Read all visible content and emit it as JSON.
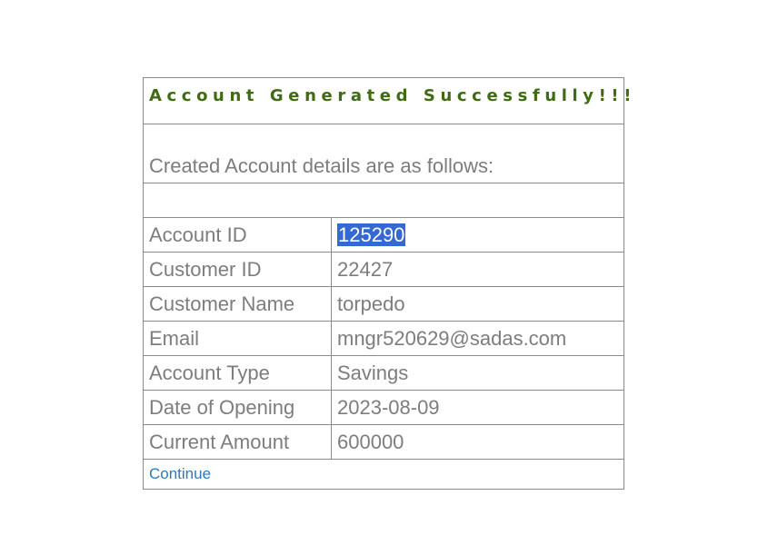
{
  "title": "Account Generated Successfully!!!",
  "subtitle": "Created Account details are as follows:",
  "rows": [
    {
      "label": "Account ID",
      "value": "125290"
    },
    {
      "label": "Customer ID",
      "value": "22427"
    },
    {
      "label": "Customer Name",
      "value": "torpedo"
    },
    {
      "label": "Email",
      "value": "mngr520629@sadas.com"
    },
    {
      "label": "Account Type",
      "value": "Savings"
    },
    {
      "label": "Date of Opening",
      "value": "2023-08-09"
    },
    {
      "label": "Current Amount",
      "value": "600000"
    }
  ],
  "continue_label": "Continue",
  "colors": {
    "title": "#3f6b12",
    "text": "#7d7d7d",
    "link": "#2a7ac0",
    "selection": "#3468d2"
  }
}
